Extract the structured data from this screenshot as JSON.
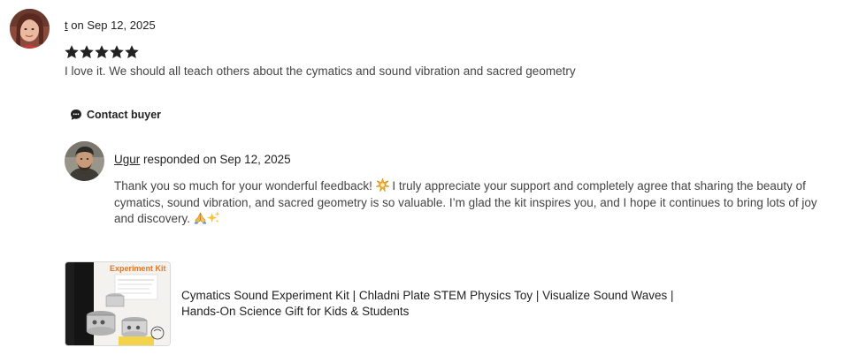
{
  "review": {
    "reviewer_name": "t",
    "date_text": "on Sep 12, 2025",
    "rating": 5,
    "rating_max": 5,
    "text": "I love it. We should all teach others about the cymatics and sound vibration and sacred geometry",
    "contact_buyer_label": "Contact buyer"
  },
  "response": {
    "seller_name": "Ugur",
    "responded_text": "responded on Sep 12, 2025",
    "text_part1": "Thank you so much for your wonderful feedback! ",
    "emoji1": "sparkle-burst",
    "text_part2": " I truly appreciate your support and completely agree that sharing the beauty of cymatics, sound vibration, and sacred geometry is so valuable. I’m glad the kit inspires you, and I hope it continues to bring lots of joy and discovery. ",
    "emoji2": "folded-hands",
    "emoji3": "sparkles"
  },
  "listing": {
    "title_line1": "Cymatics Sound Experiment Kit | Chladni Plate STEM Physics Toy | Visualize Sound Waves |",
    "title_line2": "Hands-On Science Gift for Kids & Students",
    "thumb_label": "Experiment Kit"
  },
  "colors": {
    "star": "#222222",
    "text": "#222222",
    "muted_text": "#444444",
    "thumb_label": "#e8731c"
  }
}
